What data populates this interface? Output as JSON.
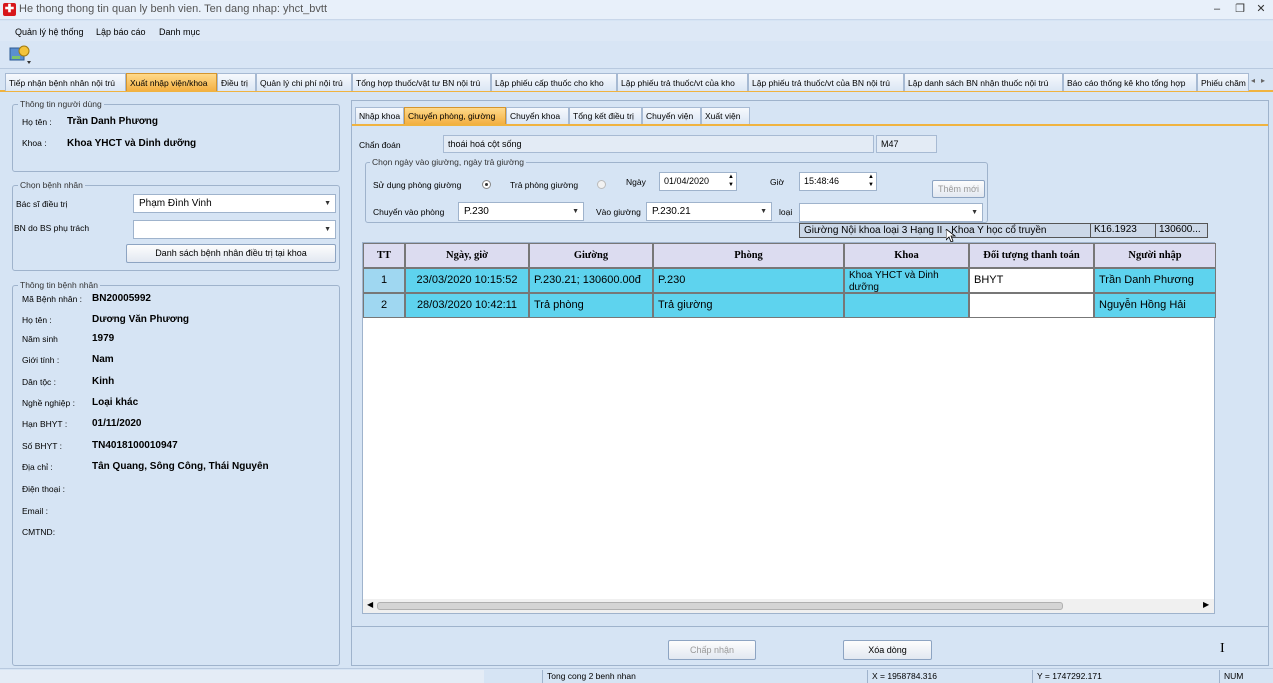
{
  "window": {
    "title": "He thong thong tin quan ly benh vien. Ten dang nhap: yhct_bvtt"
  },
  "menu": [
    "Quản lý hệ thống",
    "Lập báo cáo",
    "Danh mục"
  ],
  "main_tabs": [
    "Tiếp nhận bệnh nhân nội trú",
    "Xuất nhập viện/khoa",
    "Điều trị",
    "Quản lý chi phí nội trú",
    "Tổng hợp thuốc/vật tư BN nội trú",
    "Lập phiếu cấp thuốc cho kho",
    "Lập phiếu trả thuốc/vt của kho",
    "Lập phiếu trả thuốc/vt của BN nội trú",
    "Lập danh sách BN nhận thuốc nội trú",
    "Báo cáo thống kê kho tổng hợp",
    "Phiếu chăm"
  ],
  "user_info": {
    "title": "Thông tin người dùng",
    "name_label": "Họ tên :",
    "name": "Trần Danh Phương",
    "dept_label": "Khoa :",
    "dept": "Khoa YHCT và Dinh dưỡng"
  },
  "choose_patient": {
    "title": "Chọn bệnh nhân",
    "doctor_label": "Bác sĩ điều trị",
    "doctor_value": "Phạm Đình Vinh",
    "bs_label": "BN do BS phụ trách",
    "bs_value": "",
    "list_button": "Danh sách bệnh nhân điều trị tại khoa"
  },
  "patient_info": {
    "title": "Thông tin bệnh nhân",
    "fields": [
      {
        "label": "Mã Bệnh nhân :",
        "value": "BN20005992"
      },
      {
        "label": "Họ tên :",
        "value": "Dương Văn Phương"
      },
      {
        "label": "Năm sinh",
        "value": "1979"
      },
      {
        "label": "Giới tính :",
        "value": "Nam"
      },
      {
        "label": "Dân tộc :",
        "value": "Kinh"
      },
      {
        "label": "Nghề nghiệp :",
        "value": "Loại khác"
      },
      {
        "label": "Hạn BHYT :",
        "value": "01/11/2020"
      },
      {
        "label": "Số BHYT :",
        "value": "TN4018100010947"
      },
      {
        "label": "Địa chỉ :",
        "value": "Tân Quang, Sông Công, Thái Nguyên"
      },
      {
        "label": "Điện thoại :",
        "value": ""
      },
      {
        "label": "Email :",
        "value": ""
      },
      {
        "label": "CMTND:",
        "value": ""
      }
    ]
  },
  "sub_tabs": [
    "Nhập khoa",
    "Chuyển phòng, giường",
    "Chuyển khoa",
    "Tổng kết điều trị",
    "Chuyển viện",
    "Xuất viện"
  ],
  "diagnosis": {
    "label": "Chẩn đoán",
    "value": "thoái hoá cột sống",
    "code": "M47"
  },
  "bed_group": {
    "title": "Chọn ngày vào giường, ngày trả giường",
    "use_room_label": "Sử dụng phòng giường",
    "return_room_label": "Trả phòng giường",
    "date_label": "Ngày",
    "date_value": "01/04/2020",
    "time_label": "Giờ",
    "time_value": "15:48:46",
    "add_button": "Thêm mới",
    "room_label": "Chuyển vào phòng",
    "room_value": "P.230",
    "bed_label": "Vào giường",
    "bed_value": "P.230.21",
    "type_label": "loại",
    "type_value": ""
  },
  "dropdown_row": [
    "Giường Nội khoa loại 3 Hạng II - Khoa Y học cổ truyền",
    "K16.1923",
    "130600..."
  ],
  "grid": {
    "headers": [
      "TT",
      "Ngày, giờ",
      "Giường",
      "Phòng",
      "Khoa",
      "Đối tượng thanh toán",
      "Người nhập"
    ],
    "rows": [
      [
        "1",
        "23/03/2020 10:15:52",
        "P.230.21; 130600.00đ",
        "P.230",
        "Khoa YHCT và Dinh dưỡng",
        "BHYT",
        "Trần Danh Phương"
      ],
      [
        "2",
        "28/03/2020 10:42:11",
        "Trả phòng",
        "Trả giường",
        "",
        "",
        "Nguyễn Hồng Hải"
      ]
    ]
  },
  "buttons": {
    "accept": "Chấp nhận",
    "delete_row": "Xóa dòng"
  },
  "status": {
    "count": "Tong cong 2 benh nhan",
    "x": "X = 1958784.316",
    "y": "Y = 1747292.171",
    "num": "NUM"
  }
}
